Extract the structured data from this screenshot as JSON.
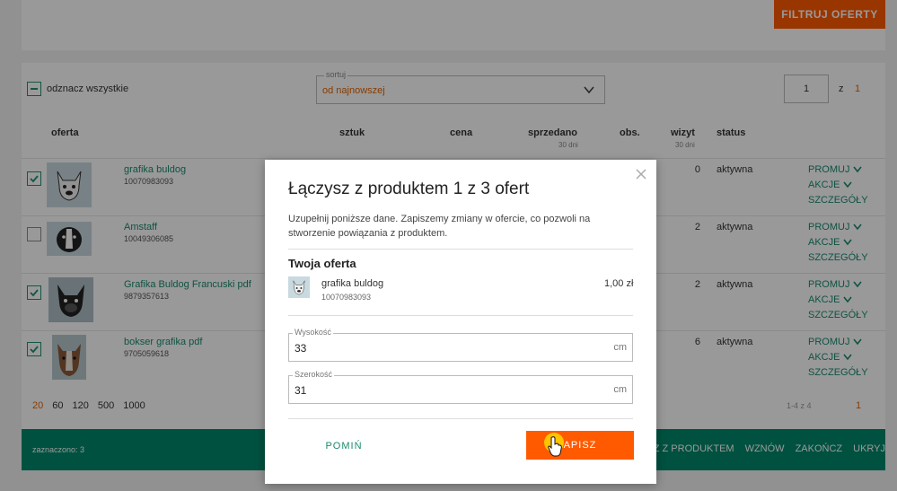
{
  "header": {
    "filter_label": "FILTRUJ OFERTY"
  },
  "toolbar": {
    "select_all_label": "odznacz wszystkie",
    "sort_legend": "sortuj",
    "sort_value": "od najnowszej",
    "page_input": "1",
    "page_of": "z",
    "page_total": "1"
  },
  "columns": {
    "offer": "oferta",
    "quantity": "sztuk",
    "price": "cena",
    "sold": "sprzedano",
    "sold_sub": "30 dni",
    "obs": "obs.",
    "visits": "wizyt",
    "visits_sub": "30 dni",
    "status": "status"
  },
  "rows": [
    {
      "name": "grafika buldog",
      "id": "10070983093",
      "visits": "0",
      "status": "aktywna",
      "checked": true
    },
    {
      "name": "Amstaff",
      "id": "10049306085",
      "visits": "2",
      "status": "aktywna",
      "checked": false
    },
    {
      "name": "Grafika Buldog Francuski pdf",
      "id": "9879357613",
      "visits": "2",
      "status": "aktywna",
      "checked": true
    },
    {
      "name": "bokser grafika pdf",
      "id": "9705059618",
      "visits": "6",
      "status": "aktywna",
      "checked": true
    }
  ],
  "row_actions": {
    "promote": "PROMUJ",
    "actions": "AKCJE",
    "details": "SZCZEGÓŁY"
  },
  "pagination": {
    "sizes": [
      "20",
      "60",
      "120",
      "500",
      "1000"
    ],
    "range": "1-4 z 4",
    "page": "1"
  },
  "bottom_bar": {
    "selected_count": "zaznaczono: 3",
    "actions": [
      "ĄCZ Z PRODUKTEM",
      "WZNÓW",
      "ZAKOŃCZ",
      "UKRYJ"
    ]
  },
  "modal": {
    "title": "Łączysz z produktem 1 z 3 ofert",
    "description": "Uzupełnij poniższe dane. Zapiszemy zmiany w ofercie, co pozwoli na stworzenie powiązania z produktem.",
    "section_title": "Twoja oferta",
    "offer_name": "grafika buldog",
    "offer_id": "10070983093",
    "offer_price": "1,00 zł",
    "height_label": "Wysokość",
    "height_value": "33",
    "height_unit": "cm",
    "width_label": "Szerokość",
    "width_value": "31",
    "width_unit": "cm",
    "skip_label": "POMIŃ",
    "save_label": "APISZ"
  },
  "colors": {
    "accent": "#ff5a00",
    "brand_green": "#00876c",
    "link_green": "#1a8a70"
  }
}
